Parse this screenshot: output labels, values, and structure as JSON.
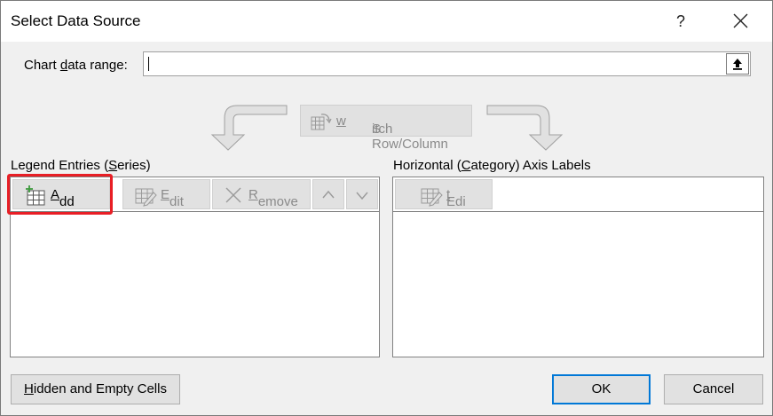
{
  "window": {
    "title": "Select Data Source",
    "help_label": "?"
  },
  "range": {
    "label_pre": "Chart ",
    "label_key": "d",
    "label_post": "ata range:",
    "value": ""
  },
  "switch": {
    "pre": "S",
    "key": "w",
    "post": "itch Row/Column"
  },
  "legend": {
    "label_pre": "Legend Entries (",
    "label_key": "S",
    "label_post": "eries)",
    "add_key": "A",
    "add_rest": "dd",
    "edit_key": "E",
    "edit_rest": "dit",
    "remove_key": "R",
    "remove_rest": "emove",
    "items": []
  },
  "axis": {
    "label_pre": "Horizontal (",
    "label_key": "C",
    "label_post": "ategory) Axis Labels",
    "edit_pre": "Edi",
    "edit_key": "t",
    "items": []
  },
  "footer": {
    "hidden_key": "H",
    "hidden_rest": "idden and Empty Cells",
    "ok_label": "OK",
    "cancel_label": "Cancel"
  },
  "colors": {
    "highlight": "#e81e25",
    "accent": "#0078d7",
    "add_icon_green": "#3c9a3c"
  }
}
